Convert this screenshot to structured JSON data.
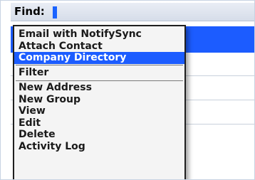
{
  "find_bar": {
    "label": "Find:",
    "value": ""
  },
  "menu": {
    "items": [
      {
        "label": "Email with NotifySync",
        "selected": false
      },
      {
        "label": "Attach Contact",
        "selected": false
      },
      {
        "label": "Company Directory",
        "selected": true
      },
      {
        "label": "Filter",
        "selected": false
      },
      {
        "label": "New Address",
        "selected": false
      },
      {
        "label": "New Group",
        "selected": false
      },
      {
        "label": "View",
        "selected": false
      },
      {
        "label": "Edit",
        "selected": false
      },
      {
        "label": "Delete",
        "selected": false
      },
      {
        "label": "Activity Log",
        "selected": false
      }
    ]
  },
  "colors": {
    "highlight": "#1c5cff",
    "cursor": "#1a63ff",
    "menu_background": "#f4f4f4"
  }
}
